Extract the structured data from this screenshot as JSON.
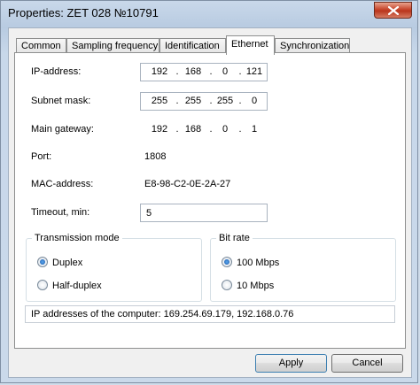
{
  "window": {
    "title": "Properties: ZET 028 №10791"
  },
  "tabs": [
    {
      "label": "Common"
    },
    {
      "label": "Sampling frequency"
    },
    {
      "label": "Identification"
    },
    {
      "label": "Ethernet"
    },
    {
      "label": "Synchronization"
    }
  ],
  "ethernet": {
    "ip_label": "IP-address:",
    "ip": [
      "192",
      "168",
      "0",
      "121"
    ],
    "subnet_label": "Subnet mask:",
    "subnet": [
      "255",
      "255",
      "255",
      "0"
    ],
    "gateway_label": "Main gateway:",
    "gateway": [
      "192",
      "168",
      "0",
      "1"
    ],
    "port_label": "Port:",
    "port_value": "1808",
    "mac_label": "MAC-address:",
    "mac_value": "E8-98-C2-0E-2A-27",
    "timeout_label": "Timeout, min:",
    "timeout_value": "5",
    "transmission": {
      "title": "Transmission mode",
      "options": [
        "Duplex",
        "Half-duplex"
      ],
      "selected": "Duplex"
    },
    "bitrate": {
      "title": "Bit rate",
      "options": [
        "100 Mbps",
        "10 Mbps"
      ],
      "selected": "100 Mbps"
    },
    "info": "IP addresses of the computer: 169.254.69.179, 192.168.0.76"
  },
  "buttons": {
    "apply": "Apply",
    "cancel": "Cancel"
  }
}
